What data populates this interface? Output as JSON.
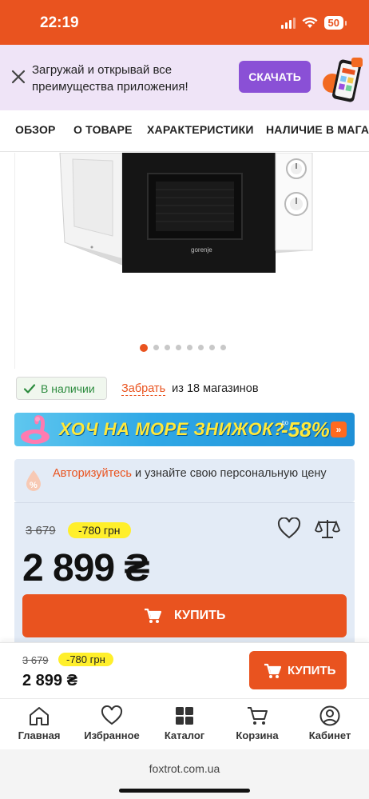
{
  "status_bar": {
    "time": "22:19",
    "battery": "50"
  },
  "app_banner": {
    "text": "Загружай и открывай все преимущества приложения!",
    "button": "СКАЧАТЬ"
  },
  "tabs": [
    "ОБЗОР",
    "О ТОВАРЕ",
    "ХАРАКТЕРИСТИКИ",
    "НАЛИЧИЕ В МАГАЗИ"
  ],
  "gallery": {
    "brand": "gorenje",
    "dots_total": 8,
    "active_dot": 1
  },
  "availability": {
    "badge": "В наличии",
    "pickup_link": "Забрать",
    "pickup_text": "из 18 магазинов"
  },
  "promo_banner": {
    "text": "ХОЧ НА МОРЕ ЗНИЖОК?",
    "prefix": "до",
    "percent": "-58%",
    "arrow": "»"
  },
  "auth_notice": {
    "link": "Авторизуйтесь",
    "text": " и узнайте свою персональную цену"
  },
  "price_block": {
    "old_price": "3 679",
    "discount": "-780 грн",
    "price": "2 899 ₴",
    "buy_label": "КУПИТЬ"
  },
  "sticky_bar": {
    "old_price": "3 679",
    "discount": "-780 грн",
    "price": "2 899 ₴",
    "buy_label": "КУПИТЬ"
  },
  "bottom_nav": [
    {
      "label": "Главная",
      "icon": "home-icon"
    },
    {
      "label": "Избранное",
      "icon": "heart-icon"
    },
    {
      "label": "Каталог",
      "icon": "grid-icon"
    },
    {
      "label": "Корзина",
      "icon": "cart-icon"
    },
    {
      "label": "Кабинет",
      "icon": "user-icon"
    }
  ],
  "browser": {
    "url": "foxtrot.com.ua"
  },
  "colors": {
    "brand": "#e9531f",
    "banner_bg": "#efe4f7",
    "banner_button": "#8a50d6",
    "price_bg": "#e3ebf6",
    "discount": "#ffef2b",
    "in_stock": "#2c8b3e"
  }
}
